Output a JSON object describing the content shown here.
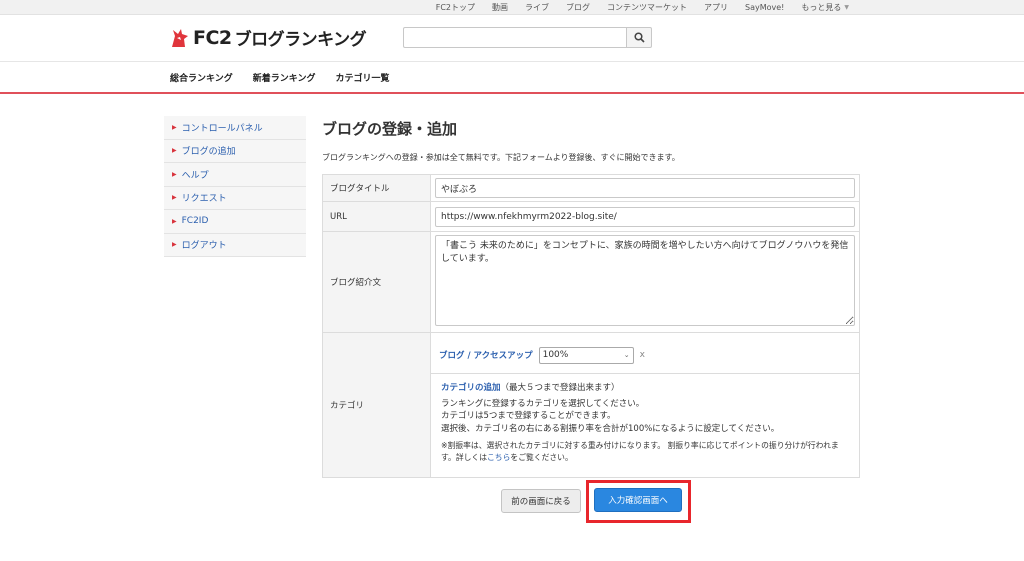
{
  "topnav": {
    "items": [
      "FC2トップ",
      "動画",
      "ライブ",
      "ブログ",
      "コンテンツマーケット",
      "アプリ",
      "SayMove!"
    ],
    "more": "もっと見る"
  },
  "header": {
    "logo_fc2": "FC2",
    "logo_text": "ブログランキング",
    "search_value": ""
  },
  "mainnav": [
    "総合ランキング",
    "新着ランキング",
    "カテゴリ一覧"
  ],
  "sidebar": [
    "コントロールパネル",
    "ブログの追加",
    "ヘルプ",
    "リクエスト",
    "FC2ID",
    "ログアウト"
  ],
  "page": {
    "title": "ブログの登録・追加",
    "description": "ブログランキングへの登録・参加は全て無料です。下記フォームより登録後、すぐに開始できます。"
  },
  "form": {
    "title_label": "ブログタイトル",
    "title_value": "やぼぶろ",
    "url_label": "URL",
    "url_value": "https://www.nfekhmyrm2022-blog.site/",
    "intro_label": "ブログ紹介文",
    "intro_value": "「書こう 未来のために」をコンセプトに、家族の時間を増やしたい方へ向けてブログノウハウを発信しています。",
    "category_label": "カテゴリ",
    "category_name": "ブログ / アクセスアップ",
    "category_ratio": "100%",
    "category_remove": "x",
    "add_category_link": "カテゴリの追加",
    "add_category_note": "（最大５つまで登録出来ます）",
    "help_line1": "ランキングに登録するカテゴリを選択してください。",
    "help_line2": "カテゴリは5つまで登録することができます。",
    "help_line3": "選択後、カテゴリ名の右にある割振り率を合計が100%になるように設定してください。",
    "note_text1": "※割振率は、選択されたカテゴリに対する重み付けになります。 割振り率に応じてポイントの振り分けが行われます。詳しくは",
    "note_link": "こちら",
    "note_text2": "をご覧ください。"
  },
  "buttons": {
    "back": "前の画面に戻る",
    "next": "入力確認画面へ"
  },
  "colors": {
    "accent_red": "#e0505a",
    "link_blue": "#2b5fae",
    "primary_button": "#2a87e0",
    "highlight_box": "#e8262c"
  }
}
